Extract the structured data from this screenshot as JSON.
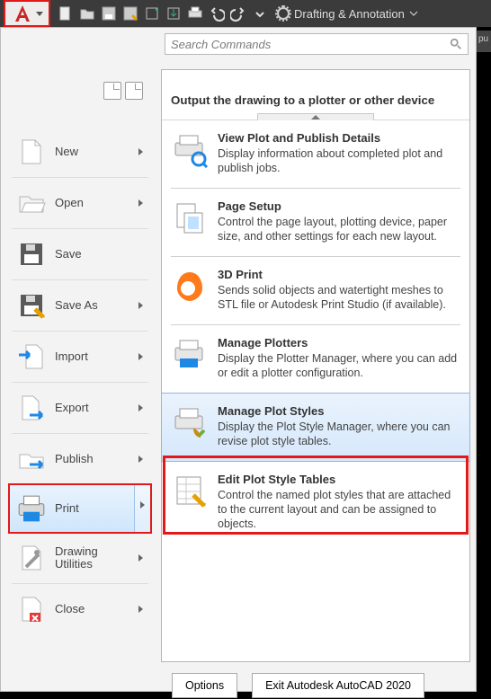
{
  "toolbar": {
    "workspace_label": "Drafting & Annotation",
    "right_stub": "pu"
  },
  "search": {
    "placeholder": "Search Commands"
  },
  "menu": {
    "items": [
      {
        "label": "New",
        "chevron": true,
        "icon": "new-doc-icon"
      },
      {
        "label": "Open",
        "chevron": true,
        "icon": "open-folder-icon"
      },
      {
        "label": "Save",
        "chevron": false,
        "icon": "save-icon"
      },
      {
        "label": "Save As",
        "chevron": true,
        "icon": "saveas-icon"
      },
      {
        "label": "Import",
        "chevron": true,
        "icon": "import-icon"
      },
      {
        "label": "Export",
        "chevron": true,
        "icon": "export-icon"
      },
      {
        "label": "Publish",
        "chevron": true,
        "icon": "publish-icon"
      },
      {
        "label": "Print",
        "chevron": true,
        "icon": "print-icon",
        "selected": true
      },
      {
        "label": "Drawing Utilities",
        "chevron": true,
        "icon": "utilities-icon"
      },
      {
        "label": "Close",
        "chevron": true,
        "icon": "close-file-icon"
      }
    ]
  },
  "output": {
    "heading": "Output the drawing to a plotter or other device",
    "items": [
      {
        "title": "View Plot and Publish Details",
        "desc": "Display information about completed plot and publish jobs.",
        "icon": "view-plot-icon"
      },
      {
        "title": "Page Setup",
        "desc": "Control the page layout, plotting device, paper size, and other settings for each new layout.",
        "icon": "page-setup-icon"
      },
      {
        "title": "3D Print",
        "desc": "Sends solid objects and watertight meshes to STL file or Autodesk Print Studio (if available).",
        "icon": "3d-print-icon"
      },
      {
        "title": "Manage Plotters",
        "desc": "Display the Plotter Manager, where you can add or edit a plotter configuration.",
        "icon": "manage-plotters-icon"
      },
      {
        "title": "Manage Plot Styles",
        "desc": "Display the Plot Style Manager, where you can revise plot style tables.",
        "icon": "manage-plot-styles-icon",
        "highlight": true
      },
      {
        "title": "Edit Plot Style Tables",
        "desc": "Control the named plot styles that are attached to the current layout and can be assigned to objects.",
        "icon": "edit-plot-style-tables-icon"
      }
    ]
  },
  "buttons": {
    "options": "Options",
    "exit": "Exit Autodesk AutoCAD 2020"
  }
}
